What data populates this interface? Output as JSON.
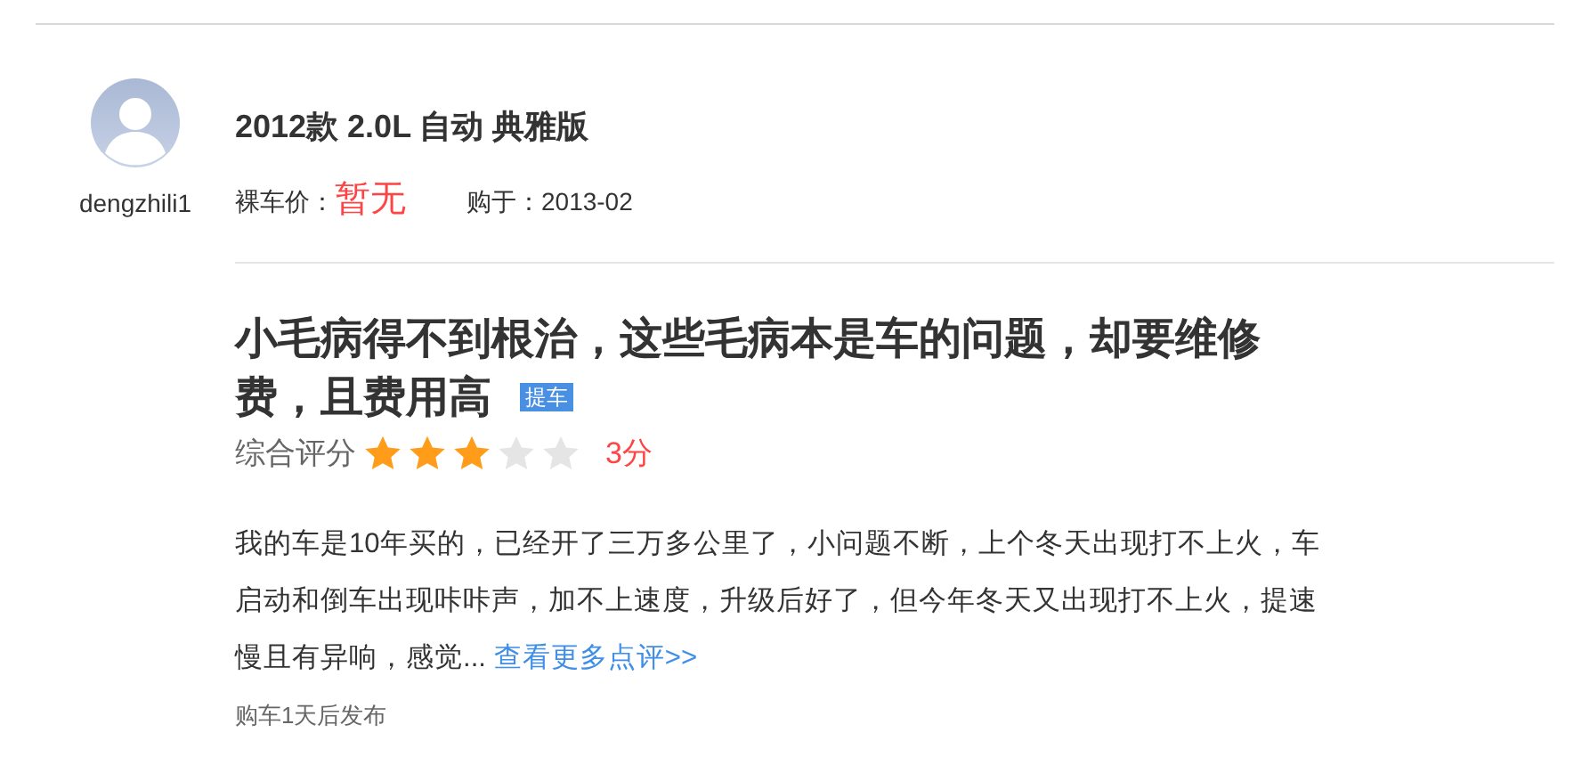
{
  "user": {
    "name": "dengzhili1"
  },
  "car": {
    "model": "2012款 2.0L 自动 典雅版",
    "price_label": "裸车价：",
    "price": "暂无",
    "purchase_label": "购于：",
    "purchase_date": "2013-02"
  },
  "review": {
    "title": "小毛病得不到根治，这些毛病本是车的问题，却要维修费，且费用高",
    "tag": "提车",
    "rating_label": "综合评分",
    "stars": 3,
    "score": "3分",
    "body": "我的车是10年买的，已经开了三万多公里了，小问题不断，上个冬天出现打不上火，车启动和倒车出现咔咔声，加不上速度，升级后好了，但今年冬天又出现打不上火，提速慢且有异响，感觉...",
    "more_link": "查看更多点评>>",
    "posted": "购车1天后发布"
  }
}
